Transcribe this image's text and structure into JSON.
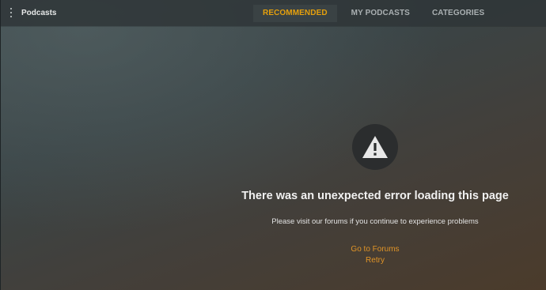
{
  "header": {
    "title": "Podcasts",
    "tabs": [
      {
        "label": "RECOMMENDED",
        "active": true
      },
      {
        "label": "MY PODCASTS",
        "active": false
      },
      {
        "label": "CATEGORIES",
        "active": false
      }
    ]
  },
  "error": {
    "icon": "warning-icon",
    "heading": "There was an unexpected error loading this page",
    "message": "Please visit our forums if you continue to experience problems",
    "links": {
      "forums": "Go to Forums",
      "retry": "Retry"
    }
  },
  "colors": {
    "accent": "#e5a00d",
    "link": "#e09427"
  }
}
